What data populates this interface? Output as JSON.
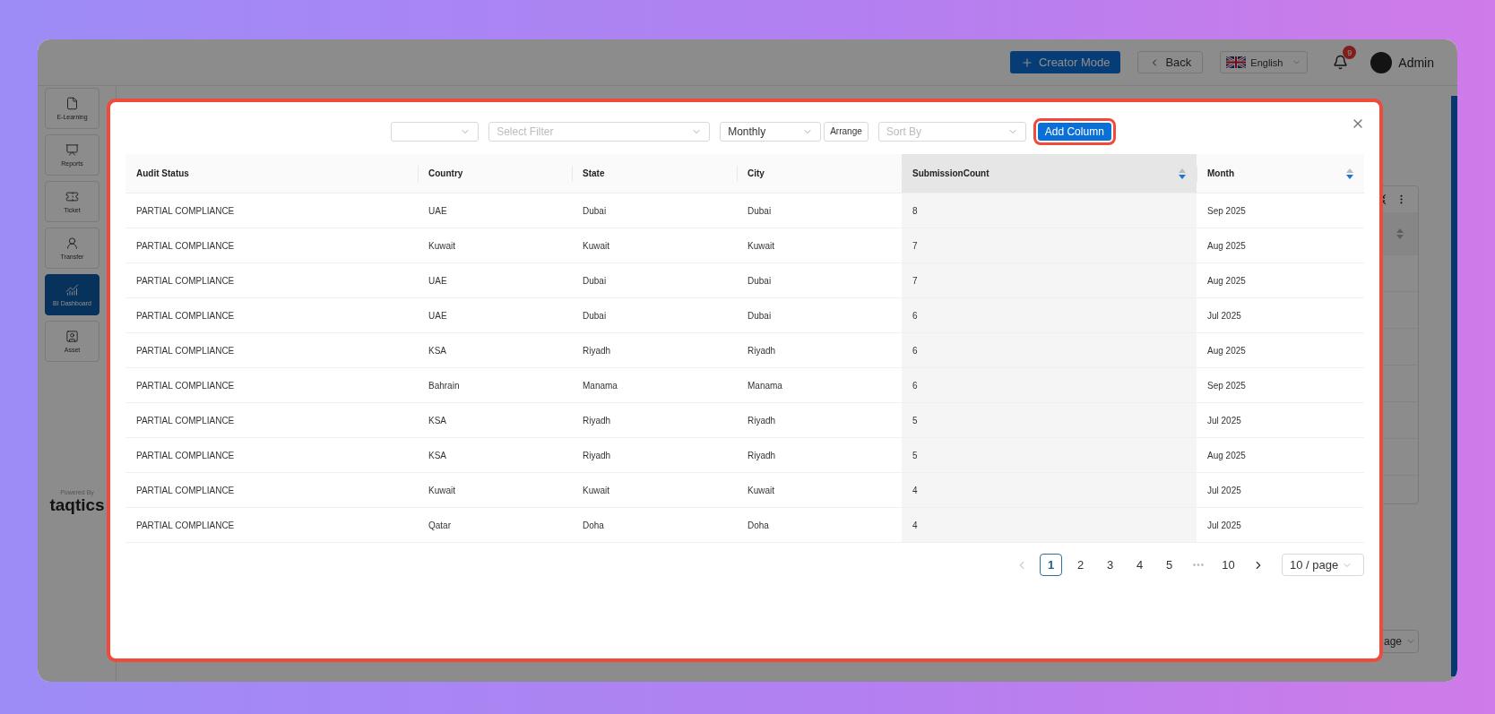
{
  "header": {
    "buttons": [
      {
        "label": "Creator Mode",
        "kind": "primary"
      },
      {
        "label": "Back",
        "kind": "back"
      }
    ],
    "language": "English",
    "notifications": "9",
    "user": "Admin"
  },
  "sidebar": {
    "items": [
      {
        "label": "E-Learning",
        "selected": false
      },
      {
        "label": "Reports",
        "selected": false
      },
      {
        "label": "Ticket",
        "selected": false
      },
      {
        "label": "Transfer",
        "selected": false
      },
      {
        "label": "BI Dashboard",
        "selected": true
      },
      {
        "label": "Asset",
        "selected": false
      }
    ],
    "powered_by": "Powered By",
    "brand": "taqtics"
  },
  "background_pager": {
    "page_size": "age"
  },
  "modal": {
    "filters": [
      {
        "kind": "select"
      },
      {
        "kind": "select",
        "placeholder": "Select Filter"
      },
      {
        "kind": "select",
        "value": "Monthly"
      },
      {
        "kind": "button",
        "label": "Arrange"
      },
      {
        "kind": "select",
        "placeholder": "Sort By"
      },
      {
        "kind": "primary",
        "label": "Add Column",
        "highlighted": true
      }
    ],
    "table": {
      "columns": [
        {
          "label": "Audit Status",
          "active": false
        },
        {
          "label": "Country",
          "active": false
        },
        {
          "label": "State",
          "active": false
        },
        {
          "label": "City",
          "active": false
        },
        {
          "label": "SubmissionCount",
          "active": true,
          "sorted_desc": true
        },
        {
          "label": "Month",
          "active": false,
          "sorted_desc": true
        }
      ],
      "rows": [
        [
          "PARTIAL COMPLIANCE",
          "UAE",
          "Dubai",
          "Dubai",
          "8",
          "Sep 2025"
        ],
        [
          "PARTIAL COMPLIANCE",
          "Kuwait",
          "Kuwait",
          "Kuwait",
          "7",
          "Aug 2025"
        ],
        [
          "PARTIAL COMPLIANCE",
          "UAE",
          "Dubai",
          "Dubai",
          "7",
          "Aug 2025"
        ],
        [
          "PARTIAL COMPLIANCE",
          "UAE",
          "Dubai",
          "Dubai",
          "6",
          "Jul 2025"
        ],
        [
          "PARTIAL COMPLIANCE",
          "KSA",
          "Riyadh",
          "Riyadh",
          "6",
          "Aug 2025"
        ],
        [
          "PARTIAL COMPLIANCE",
          "Bahrain",
          "Manama",
          "Manama",
          "6",
          "Sep 2025"
        ],
        [
          "PARTIAL COMPLIANCE",
          "KSA",
          "Riyadh",
          "Riyadh",
          "5",
          "Jul 2025"
        ],
        [
          "PARTIAL COMPLIANCE",
          "KSA",
          "Riyadh",
          "Riyadh",
          "5",
          "Aug 2025"
        ],
        [
          "PARTIAL COMPLIANCE",
          "Kuwait",
          "Kuwait",
          "Kuwait",
          "4",
          "Jul 2025"
        ],
        [
          "PARTIAL COMPLIANCE",
          "Qatar",
          "Doha",
          "Doha",
          "4",
          "Jul 2025"
        ]
      ]
    },
    "pagination": {
      "prev_disabled": true,
      "pages": [
        {
          "label": "1",
          "kind": "page",
          "selected": true
        },
        {
          "label": "2",
          "kind": "page",
          "selected": false
        },
        {
          "label": "3",
          "kind": "page",
          "selected": false
        },
        {
          "label": "4",
          "kind": "page",
          "selected": false
        },
        {
          "label": "5",
          "kind": "page",
          "selected": false
        },
        {
          "label": "•••",
          "kind": "ellipsis"
        },
        {
          "label": "10",
          "kind": "page",
          "selected": false
        }
      ],
      "page_size": "10 / page"
    }
  }
}
